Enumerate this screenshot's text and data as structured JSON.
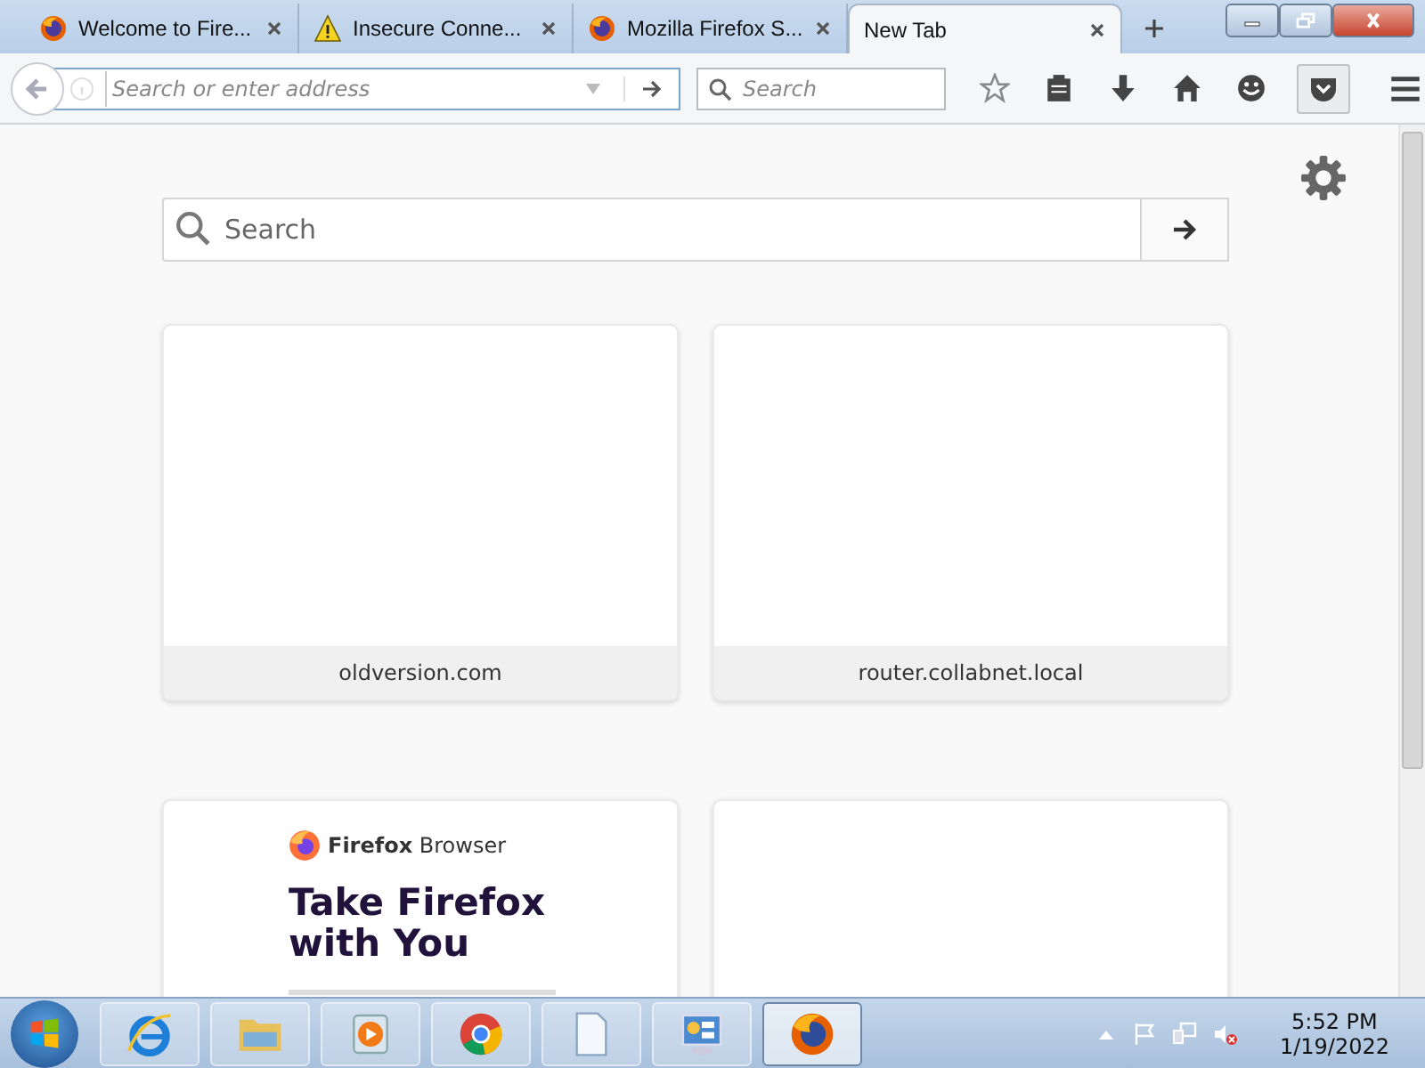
{
  "tabs": [
    {
      "title": "Welcome to Fire...",
      "kind": "firefox",
      "selected": false
    },
    {
      "title": "Insecure Conne...",
      "kind": "warning",
      "selected": false
    },
    {
      "title": "Mozilla Firefox S...",
      "kind": "firefox",
      "selected": false
    },
    {
      "title": "New Tab",
      "kind": "plain",
      "selected": true
    }
  ],
  "toolbar": {
    "address_placeholder": "Search or enter address",
    "search_placeholder": "Search"
  },
  "page": {
    "search_placeholder": "Search",
    "tiles": [
      {
        "kind": "blank",
        "label": "oldversion.com"
      },
      {
        "kind": "blank",
        "label": "router.collabnet.local"
      },
      {
        "kind": "promo",
        "brand_bold": "Firefox",
        "brand": "Browser",
        "headline": "Take Firefox with You"
      },
      {
        "kind": "blank"
      }
    ]
  },
  "taskbar": {
    "items": [
      {
        "kind": "ie",
        "active": false
      },
      {
        "kind": "folder",
        "active": false
      },
      {
        "kind": "media",
        "active": false
      },
      {
        "kind": "chrome",
        "active": false
      },
      {
        "kind": "document",
        "active": false
      },
      {
        "kind": "control",
        "active": false
      },
      {
        "kind": "firefox",
        "active": true
      }
    ],
    "time": "5:52 PM",
    "date": "1/19/2022"
  }
}
